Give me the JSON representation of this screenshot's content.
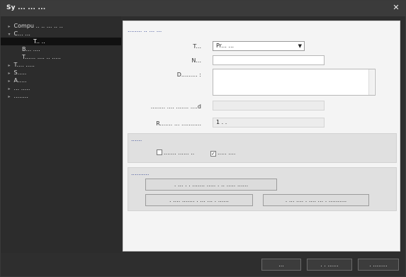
{
  "window": {
    "title": "Sy  ...  ...  ...",
    "close_label": "✕"
  },
  "sidebar": {
    "items": [
      {
        "label": "Compu .. .. ... .. ..",
        "expander": "▸"
      },
      {
        "label": "C... ...",
        "expander": "▾"
      },
      {
        "label": "T.. ..",
        "expander": ""
      },
      {
        "label": "B... ....",
        "expander": ""
      },
      {
        "label": "T...... .... .. .....",
        "expander": ""
      },
      {
        "label": "T.... .....",
        "expander": "▸"
      },
      {
        "label": "S.....",
        "expander": "▸"
      },
      {
        "label": "A.....",
        "expander": "▸"
      },
      {
        "label": "... .....",
        "expander": "▸"
      },
      {
        "label": "........",
        "expander": "▸"
      }
    ]
  },
  "form": {
    "section_title": "........ .. ... ...",
    "type_label": "T...",
    "type_value": "Pr... ...",
    "name_label": "N...",
    "desc_label": "D......... :",
    "field4_label": "........ .... ....... ....d",
    "field5_label": "R.......  ... ...........",
    "field5_value": "1 . ."
  },
  "options": {
    "title": "......",
    "chk1_label": "....... ...... ..",
    "chk1_checked": false,
    "chk2_label": "..... ....",
    "chk2_checked": true
  },
  "actions": {
    "title": "..........",
    "btn_top": ". ... . . ....... ..... . .. ..... ......",
    "btn_left": ". .... ....... . ... ... . ......",
    "btn_right": ". ... .... . .... ... . .........."
  },
  "footer": {
    "ok_label": "...",
    "cancel_label": ". . ......",
    "apply_label": ". ........"
  }
}
